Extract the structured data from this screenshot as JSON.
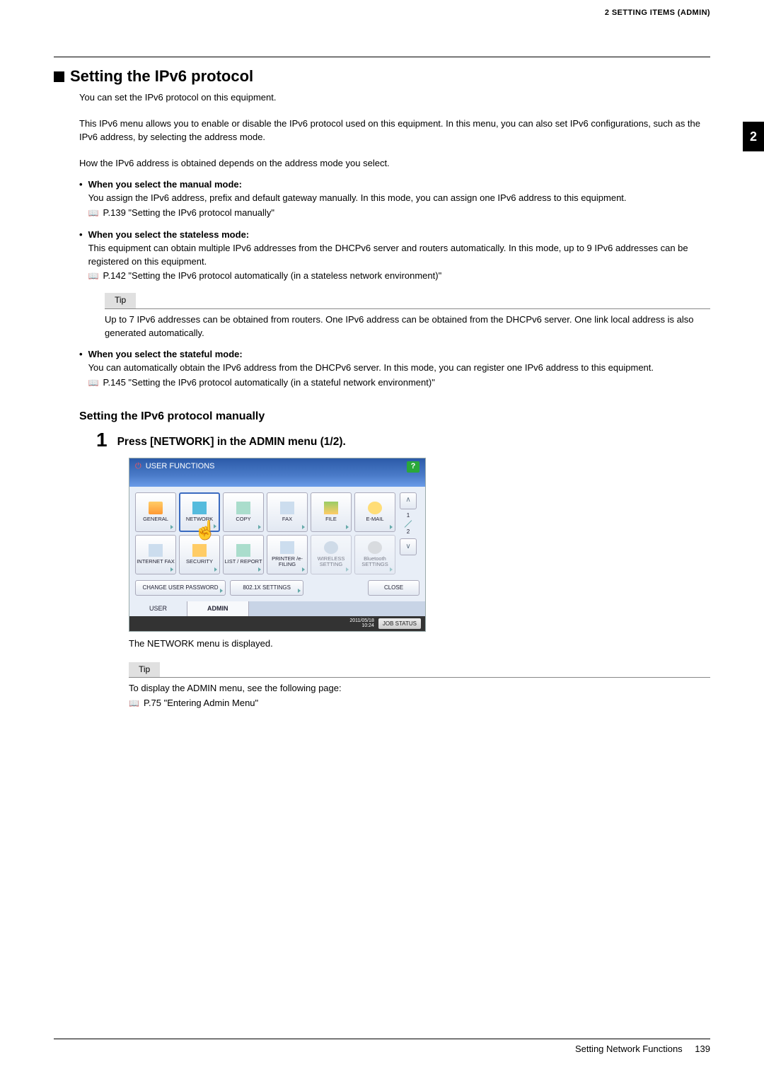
{
  "header": {
    "section_label": "2 SETTING ITEMS (ADMIN)"
  },
  "chapter_tab": "2",
  "title": "Setting the IPv6 protocol",
  "intro1": "You can set the IPv6 protocol on this equipment.",
  "intro2": "This IPv6 menu allows you to enable or disable the IPv6 protocol used on this equipment. In this menu, you can also set IPv6 configurations, such as the IPv6 address, by selecting the address mode.",
  "intro3": "How the IPv6 address is obtained depends on the address mode you select.",
  "bullets": [
    {
      "bold": "When you select the manual mode:",
      "text": "You assign the IPv6 address, prefix and default gateway manually. In this mode, you can assign one IPv6 address to this equipment.",
      "link": "P.139 \"Setting the IPv6 protocol manually\""
    },
    {
      "bold": "When you select the stateless mode:",
      "text": "This equipment can obtain multiple IPv6 addresses from the DHCPv6 server and routers automatically. In this mode, up to 9 IPv6 addresses can be registered on this equipment.",
      "link": "P.142 \"Setting the IPv6 protocol automatically (in a stateless network environment)\""
    },
    {
      "bold": "When you select the stateful mode:",
      "text": "You can automatically obtain the IPv6 address from the DHCPv6 server. In this mode, you can register one IPv6 address to this equipment.",
      "link": "P.145 \"Setting the IPv6 protocol automatically (in a stateful network environment)\""
    }
  ],
  "tip1": {
    "label": "Tip",
    "text": "Up to 7 IPv6 addresses can be obtained from routers. One IPv6 address can be obtained from the DHCPv6 server. One link local address is also generated automatically."
  },
  "subsection": "Setting the IPv6 protocol manually",
  "step": {
    "num": "1",
    "text": "Press [NETWORK] in the ADMIN menu (1/2)."
  },
  "screenshot": {
    "title": "USER FUNCTIONS",
    "help": "?",
    "row1": [
      "GENERAL",
      "NETWORK",
      "COPY",
      "FAX",
      "FILE",
      "E-MAIL"
    ],
    "row2": [
      "INTERNET FAX",
      "SECURITY",
      "LIST / REPORT",
      "PRINTER /e-FILING",
      "WIRELESS SETTING",
      "Bluetooth SETTINGS"
    ],
    "pager": {
      "page1": "1",
      "page2": "2"
    },
    "wide": [
      "CHANGE USER PASSWORD",
      "802.1X SETTINGS",
      "CLOSE"
    ],
    "tabs": [
      "USER",
      "ADMIN"
    ],
    "status": {
      "time": "2011/05/18\n10:24",
      "job": "JOB STATUS"
    }
  },
  "screenshot_note": "The NETWORK menu is displayed.",
  "tip2": {
    "label": "Tip",
    "text": "To display the ADMIN menu, see the following page:",
    "link": "P.75 \"Entering Admin Menu\""
  },
  "footer": {
    "text": "Setting Network Functions",
    "page": "139"
  }
}
